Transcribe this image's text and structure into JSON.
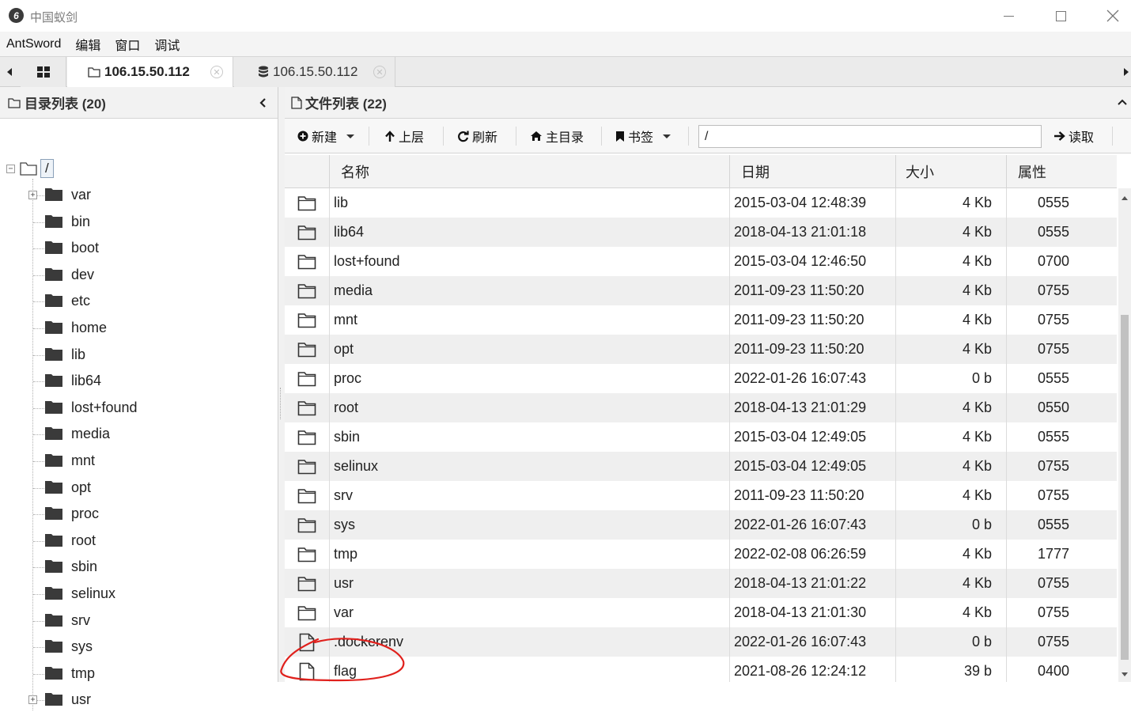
{
  "window": {
    "title": "中国蚁剑",
    "logo_glyph": "6"
  },
  "menu": [
    "AntSword",
    "编辑",
    "窗口",
    "调试"
  ],
  "tabs": [
    {
      "label": "106.15.50.112",
      "icon": "folder-icon",
      "active": true
    },
    {
      "label": "106.15.50.112",
      "icon": "database-icon",
      "active": false
    }
  ],
  "left_panel": {
    "title": "目录列表 (20)",
    "root_label": "/",
    "items": [
      {
        "label": "var",
        "expandable": true
      },
      {
        "label": "bin",
        "expandable": false
      },
      {
        "label": "boot",
        "expandable": false
      },
      {
        "label": "dev",
        "expandable": false
      },
      {
        "label": "etc",
        "expandable": false
      },
      {
        "label": "home",
        "expandable": false
      },
      {
        "label": "lib",
        "expandable": false
      },
      {
        "label": "lib64",
        "expandable": false
      },
      {
        "label": "lost+found",
        "expandable": false
      },
      {
        "label": "media",
        "expandable": false
      },
      {
        "label": "mnt",
        "expandable": false
      },
      {
        "label": "opt",
        "expandable": false
      },
      {
        "label": "proc",
        "expandable": false
      },
      {
        "label": "root",
        "expandable": false
      },
      {
        "label": "sbin",
        "expandable": false
      },
      {
        "label": "selinux",
        "expandable": false
      },
      {
        "label": "srv",
        "expandable": false
      },
      {
        "label": "sys",
        "expandable": false
      },
      {
        "label": "tmp",
        "expandable": false
      },
      {
        "label": "usr",
        "expandable": true
      }
    ]
  },
  "right_panel": {
    "title": "文件列表 (22)",
    "toolbar": {
      "new_label": "新建",
      "up_label": "上层",
      "refresh_label": "刷新",
      "home_label": "主目录",
      "bookmark_label": "书签",
      "path_value": "/",
      "read_label": "读取"
    },
    "columns": {
      "name": "名称",
      "date": "日期",
      "size": "大小",
      "attr": "属性"
    },
    "rows": [
      {
        "type": "folder",
        "name": "lib",
        "date": "2015-03-04 12:48:39",
        "size": "4 Kb",
        "attr": "0555"
      },
      {
        "type": "folder",
        "name": "lib64",
        "date": "2018-04-13 21:01:18",
        "size": "4 Kb",
        "attr": "0555"
      },
      {
        "type": "folder",
        "name": "lost+found",
        "date": "2015-03-04 12:46:50",
        "size": "4 Kb",
        "attr": "0700"
      },
      {
        "type": "folder",
        "name": "media",
        "date": "2011-09-23 11:50:20",
        "size": "4 Kb",
        "attr": "0755"
      },
      {
        "type": "folder",
        "name": "mnt",
        "date": "2011-09-23 11:50:20",
        "size": "4 Kb",
        "attr": "0755"
      },
      {
        "type": "folder",
        "name": "opt",
        "date": "2011-09-23 11:50:20",
        "size": "4 Kb",
        "attr": "0755"
      },
      {
        "type": "folder",
        "name": "proc",
        "date": "2022-01-26 16:07:43",
        "size": "0 b",
        "attr": "0555"
      },
      {
        "type": "folder",
        "name": "root",
        "date": "2018-04-13 21:01:29",
        "size": "4 Kb",
        "attr": "0550"
      },
      {
        "type": "folder",
        "name": "sbin",
        "date": "2015-03-04 12:49:05",
        "size": "4 Kb",
        "attr": "0555"
      },
      {
        "type": "folder",
        "name": "selinux",
        "date": "2015-03-04 12:49:05",
        "size": "4 Kb",
        "attr": "0755"
      },
      {
        "type": "folder",
        "name": "srv",
        "date": "2011-09-23 11:50:20",
        "size": "4 Kb",
        "attr": "0755"
      },
      {
        "type": "folder",
        "name": "sys",
        "date": "2022-01-26 16:07:43",
        "size": "0 b",
        "attr": "0555"
      },
      {
        "type": "folder",
        "name": "tmp",
        "date": "2022-02-08 06:26:59",
        "size": "4 Kb",
        "attr": "1777"
      },
      {
        "type": "folder",
        "name": "usr",
        "date": "2018-04-13 21:01:22",
        "size": "4 Kb",
        "attr": "0755"
      },
      {
        "type": "folder",
        "name": "var",
        "date": "2018-04-13 21:01:30",
        "size": "4 Kb",
        "attr": "0755"
      },
      {
        "type": "file",
        "name": ".dockerenv",
        "date": "2022-01-26 16:07:43",
        "size": "0 b",
        "attr": "0755"
      },
      {
        "type": "file",
        "name": "flag",
        "date": "2021-08-26 12:24:12",
        "size": "39 b",
        "attr": "0400"
      }
    ]
  },
  "colors": {
    "annotation": "#e0201c",
    "folder_tree": "#3a3a3a",
    "row_alt": "#efefef"
  }
}
